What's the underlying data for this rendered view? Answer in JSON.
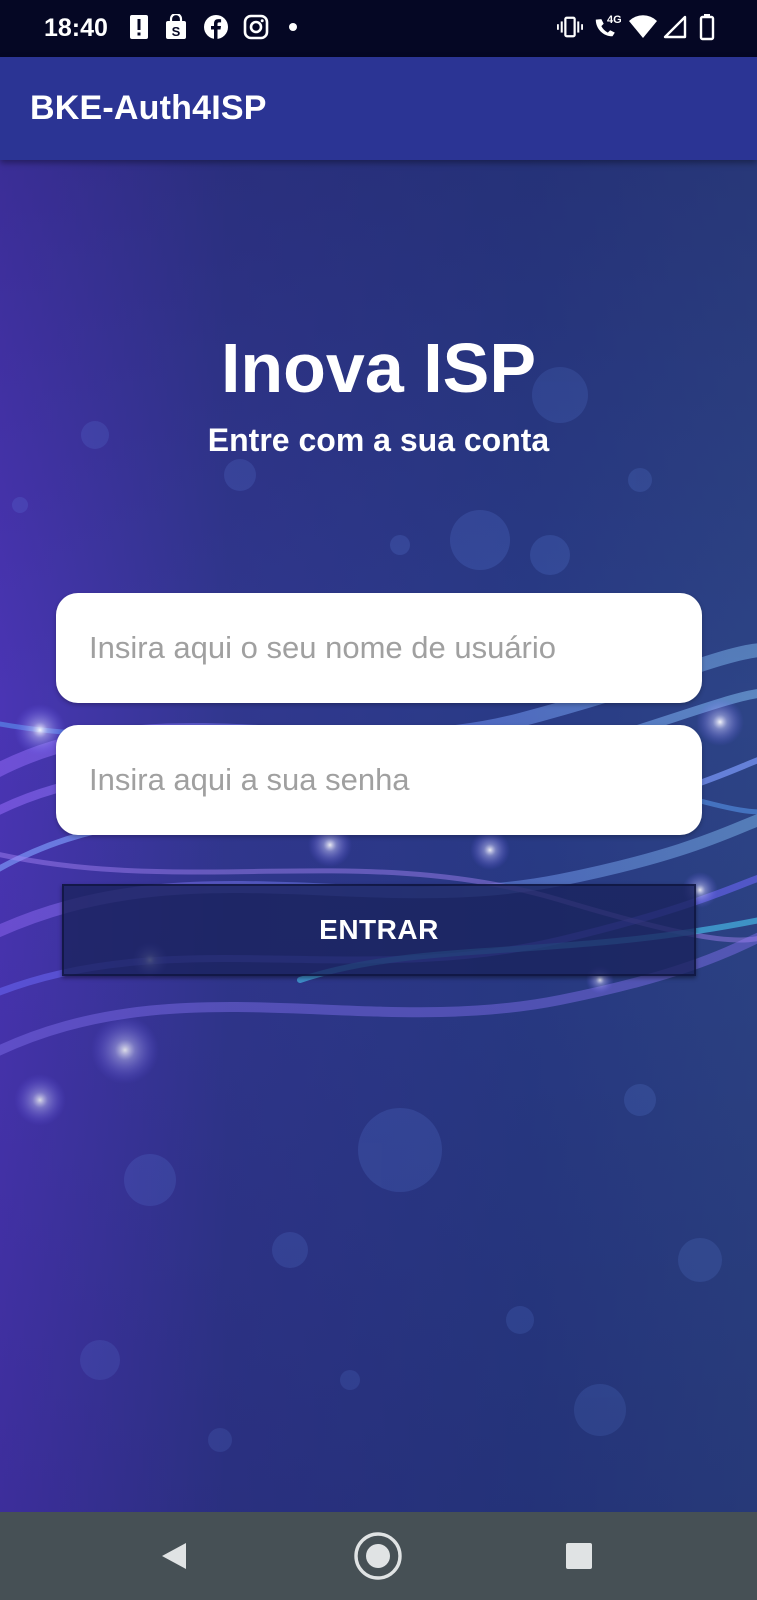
{
  "status_bar": {
    "time": "18:40",
    "left_icons": [
      "alert-icon",
      "shopping-bag-icon",
      "facebook-icon",
      "instagram-icon",
      "dot-icon"
    ],
    "right_icons": [
      "vibrate-icon",
      "call-4g-icon",
      "wifi-icon",
      "signal-icon",
      "battery-icon"
    ],
    "network_label": "4G"
  },
  "app_bar": {
    "title": "BKE-Auth4ISP",
    "color": "#2b3494"
  },
  "login": {
    "headline": "Inova ISP",
    "subheadline": "Entre com a sua conta",
    "username": {
      "value": "",
      "placeholder": "Insira aqui o seu nome de usuário"
    },
    "password": {
      "value": "",
      "placeholder": "Insira aqui a sua senha"
    },
    "submit_label": "ENTRAR"
  },
  "nav_bar": {
    "icons": [
      "back-icon",
      "home-icon",
      "recents-icon"
    ]
  },
  "colors": {
    "background": "#2a3580",
    "status_bar": "#050724",
    "nav_bar": "#465055"
  }
}
